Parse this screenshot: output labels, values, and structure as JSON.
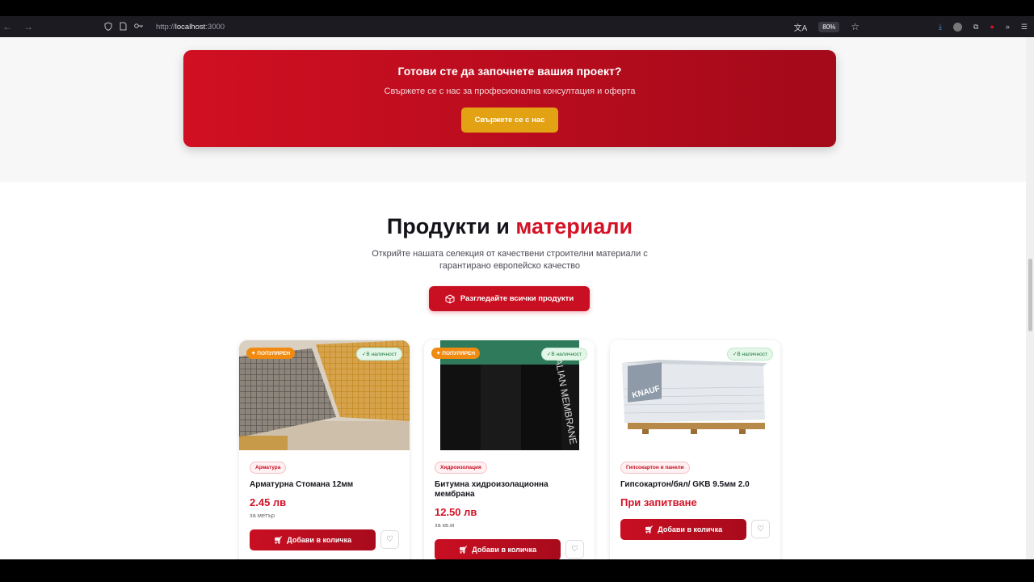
{
  "browser": {
    "url_prefix": "http://",
    "url_host": "localhost",
    "url_port": ":3000",
    "zoom": "80%"
  },
  "cta": {
    "title": "Готови сте да започнете вашия проект?",
    "subtitle": "Свържете се с нас за професионална консултация и оферта",
    "button": "Свържете се с нас"
  },
  "products": {
    "title_main": "Продукти и ",
    "title_accent": "материали",
    "subtitle": "Открийте нашата селекция от качествени строителни материали с гарантирано европейско качество",
    "browse_button": "Разгледайте всички продукти",
    "items": [
      {
        "badge": "ПОПУЛЯРЕН",
        "stock": "✓В наличност",
        "category": "Арматура",
        "name": "Арматурна Стомана 12мм",
        "price": "2.45 лв",
        "unit": "за метър",
        "add": "Добави в количка"
      },
      {
        "badge": "ПОПУЛЯРЕН",
        "stock": "✓В наличност",
        "category": "Хидроизолация",
        "name": "Битумна хидроизолационна мембрана",
        "price": "12.50 лв",
        "unit": "за кв.м",
        "add": "Добави в количка"
      },
      {
        "badge": "",
        "stock": "✓В наличност",
        "category": "Гипсокартон и панели",
        "name": "Гипсокартон/бял/ GKB 9.5мм 2.0",
        "price": "При запитване",
        "unit": "",
        "add": "Добави в количка"
      }
    ]
  },
  "colors": {
    "accent": "#d41226",
    "gold": "#e3a114"
  }
}
